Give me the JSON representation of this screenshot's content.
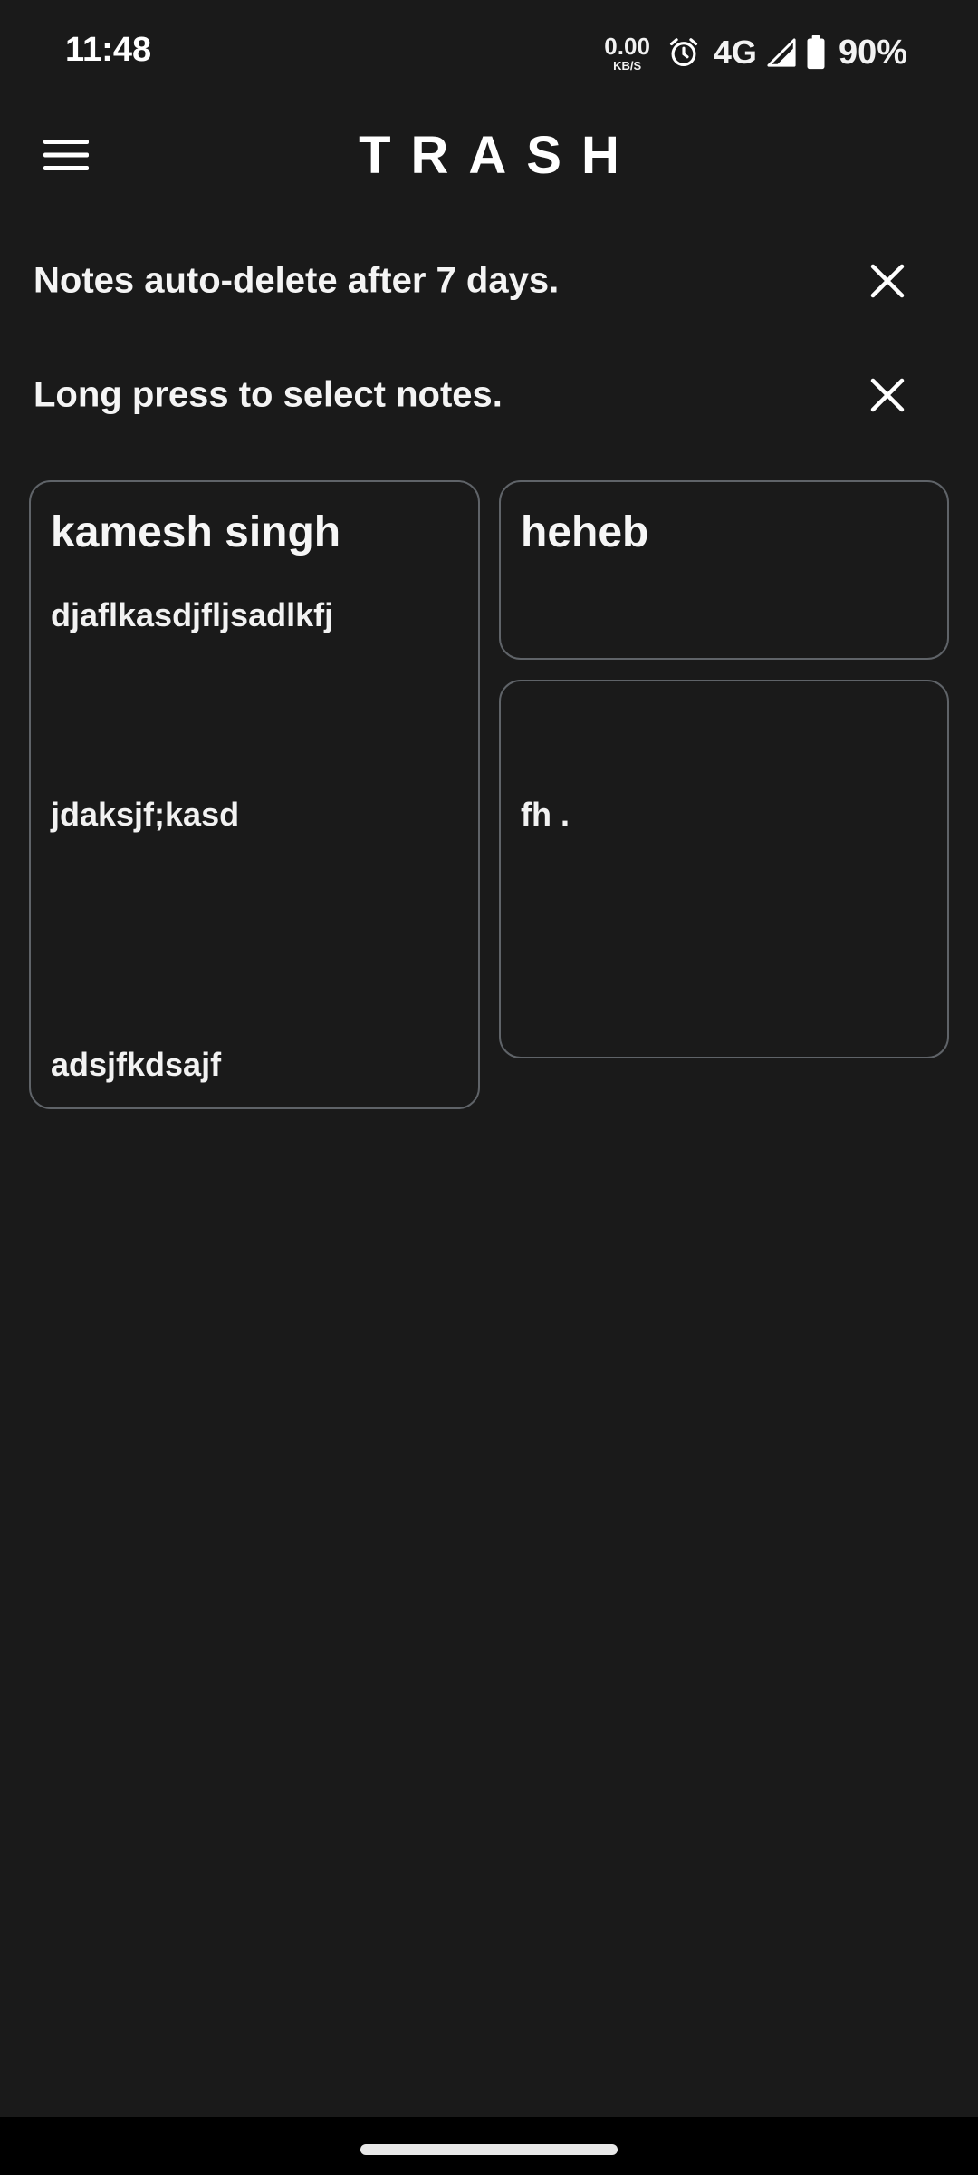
{
  "status_bar": {
    "time": "11:48",
    "net_speed_value": "0.00",
    "net_speed_unit": "KB/S",
    "network_type": "4G",
    "battery_percent": "90%",
    "icons": [
      "alarm-icon",
      "signal-icon",
      "battery-icon"
    ]
  },
  "app_bar": {
    "title": "TRASH",
    "menu_icon": "hamburger-menu-icon"
  },
  "banners": [
    {
      "text": "Notes auto-delete after 7 days.",
      "close_icon": "close-icon"
    },
    {
      "text": "Long press to select notes.",
      "close_icon": "close-icon"
    }
  ],
  "notes": [
    {
      "title": "kamesh singh",
      "lines": [
        "djaflkasdjfljsadlkfj",
        "jdaksjf;kasd",
        "adsjfkdsajf"
      ]
    },
    {
      "title": "heheb",
      "lines": []
    },
    {
      "title": "",
      "lines": [
        "fh ."
      ]
    }
  ],
  "colors": {
    "background": "#1a1a1a",
    "card_border": "#5f6368",
    "text": "#f2f2f2",
    "nav_bar": "#000000"
  }
}
